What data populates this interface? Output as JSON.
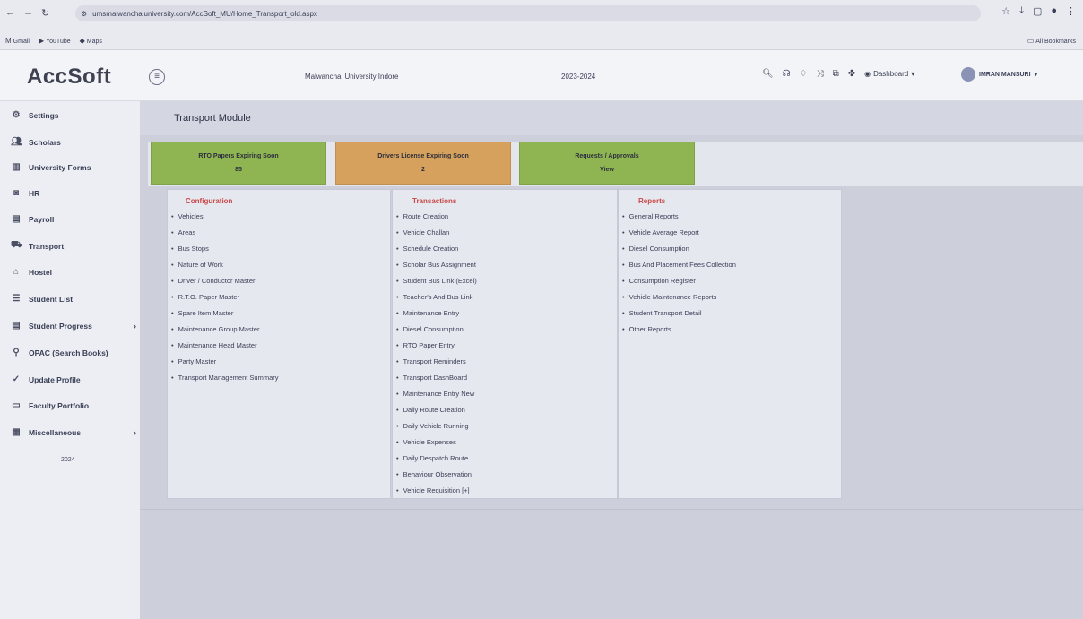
{
  "browser": {
    "url": "umsmalwanchaluniversity.com/AccSoft_MU/Home_Transport_old.aspx",
    "bookmarks": [
      "Gmail",
      "YouTube",
      "Maps"
    ],
    "all_bookmarks": "All Bookmarks"
  },
  "header": {
    "logo": "AccSoft",
    "university": "Malwanchal University Indore",
    "session": "2023-2024",
    "dashboard": "Dashboard",
    "user": "IMRAN MANSURI"
  },
  "sidebar": {
    "items": [
      {
        "label": "Settings",
        "icon": "gear-icon"
      },
      {
        "label": "Scholars",
        "icon": "users-icon"
      },
      {
        "label": "University Forms",
        "icon": "form-icon"
      },
      {
        "label": "HR",
        "icon": "hr-icon"
      },
      {
        "label": "Payroll",
        "icon": "calendar-icon"
      },
      {
        "label": "Transport",
        "icon": "bus-icon"
      },
      {
        "label": "Hostel",
        "icon": "home-icon"
      },
      {
        "label": "Student List",
        "icon": "list-icon"
      },
      {
        "label": "Student Progress",
        "icon": "calendar-icon"
      },
      {
        "label": "OPAC (Search Books)",
        "icon": "search-icon"
      },
      {
        "label": "Update Profile",
        "icon": "check-circle-icon"
      },
      {
        "label": "Faculty Portfolio",
        "icon": "portfolio-icon"
      },
      {
        "label": "Miscellaneous",
        "icon": "grid-icon"
      }
    ],
    "year": "2024"
  },
  "main": {
    "title": "Transport Module",
    "alerts": [
      {
        "label": "RTO Papers Expiring Soon",
        "value": "85",
        "color": "#8fb452"
      },
      {
        "label": "Drivers License Expiring Soon",
        "value": "2",
        "color": "#d6a15c"
      },
      {
        "label": "Requests / Approvals",
        "value": "View",
        "color": "#8fb452"
      }
    ],
    "columns": [
      {
        "title": "Configuration",
        "items": [
          "Vehicles",
          "Areas",
          "Bus Stops",
          "Nature of Work",
          "Driver / Conductor Master",
          "R.T.O. Paper Master",
          "Spare Item Master",
          "Maintenance Group Master",
          "Maintenance Head Master",
          "Party Master",
          "Transport Management Summary"
        ]
      },
      {
        "title": "Transactions",
        "items": [
          "Route Creation",
          "Vehicle Challan",
          "Schedule Creation",
          "Scholar Bus Assignment",
          "Student Bus Link (Excel)",
          "Teacher's And Bus Link",
          "Maintenance Entry",
          "Diesel Consumption",
          "RTO Paper Entry",
          "Transport Reminders",
          "Transport DashBoard",
          "Maintenance Entry New",
          "Daily Route Creation",
          "Daily Vehicle Running",
          "Vehicle Expenses",
          "Daily Despatch Route",
          "Behaviour Observation",
          "Vehicle Requisition [+]"
        ]
      },
      {
        "title": "Reports",
        "items": [
          "General Reports",
          "Vehicle Average Report",
          "Diesel Consumption",
          "Bus And Placement Fees Collection",
          "Consumption Register",
          "Vehicle Maintenance Reports",
          "Student Transport Detail",
          "Other Reports"
        ]
      }
    ]
  }
}
